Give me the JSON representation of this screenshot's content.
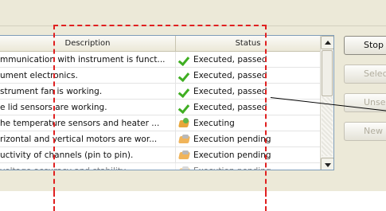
{
  "table": {
    "headers": {
      "description": "Description",
      "status": "Status"
    },
    "rows": [
      {
        "description": "mmunication with instrument is funct...",
        "status": "Executed, passed",
        "icon": "check-icon"
      },
      {
        "description": "ument electronics.",
        "status": "Executed, passed",
        "icon": "check-icon"
      },
      {
        "description": "strument fan is working.",
        "status": "Executed, passed",
        "icon": "check-icon"
      },
      {
        "description": "e lid sensors are working.",
        "status": "Executed, passed",
        "icon": "check-icon"
      },
      {
        "description": "he temperature sensors and heater ...",
        "status": "Executing",
        "icon": "executing-icon"
      },
      {
        "description": "rizontal and vertical motors are wor...",
        "status": "Execution pending",
        "icon": "pending-icon"
      },
      {
        "description": "uctivity of channels (pin to pin).",
        "status": "Execution pending",
        "icon": "pending-icon"
      },
      {
        "description": "voltage accuracy and stability",
        "status": "Execution pending",
        "icon": "pending-icon"
      }
    ]
  },
  "buttons": {
    "stop": "Stop",
    "select": "Select",
    "unselect": "Unselec",
    "new": "New"
  },
  "colors": {
    "annotation": "#e02020",
    "passed": "#3fae22"
  }
}
